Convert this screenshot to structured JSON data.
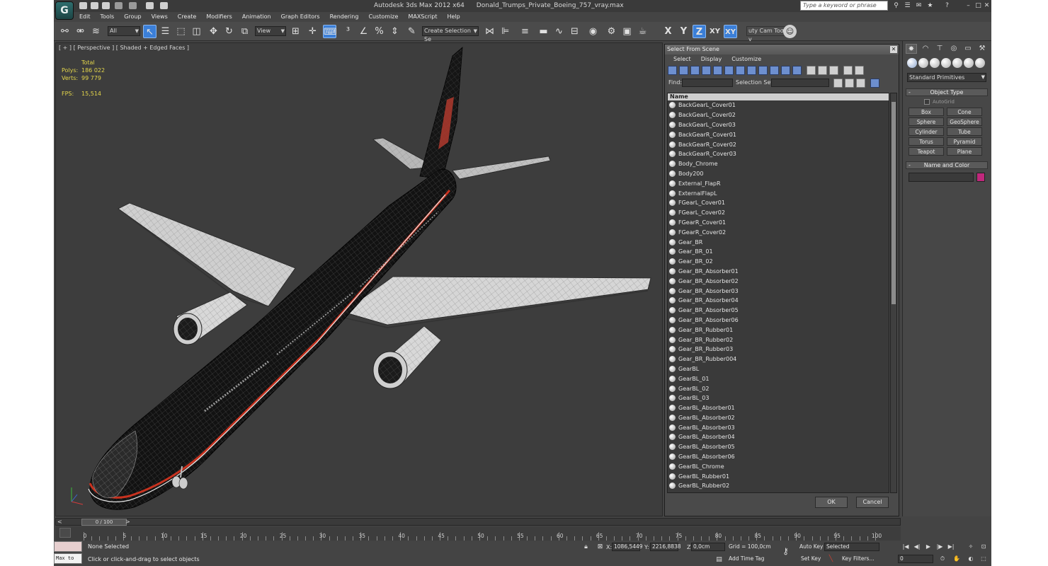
{
  "app": {
    "title_parts": [
      "Autodesk 3ds Max  2012 x64",
      "Donald_Trumps_Private_Boeing_757_vray.max"
    ],
    "logo_glyph": "G",
    "search_placeholder": "Type a keyword or phrase"
  },
  "menu": [
    "Edit",
    "Tools",
    "Group",
    "Views",
    "Create",
    "Modifiers",
    "Animation",
    "Graph Editors",
    "Rendering",
    "Customize",
    "MAXScript",
    "Help"
  ],
  "toolbar": {
    "filter_value": "All",
    "view_value": "View",
    "selection_set_placeholder": "Create Selection Se",
    "axis_x": "X",
    "axis_y": "Y",
    "axis_z": "Z",
    "axis_xy": "XY",
    "axis_xy2": "XY",
    "script_label": "uty Cam Tool v"
  },
  "viewport": {
    "label": "[ + ] [ Perspective ] [ Shaded + Edged Faces ]",
    "stats_total": "Total",
    "stats_polys_label": "Polys:",
    "stats_polys": "186 022",
    "stats_verts_label": "Verts:",
    "stats_verts": "99 779",
    "stats_fps_label": "FPS:",
    "stats_fps": "15,514"
  },
  "dialog": {
    "title": "Select From Scene",
    "menu": [
      "Select",
      "Display",
      "Customize"
    ],
    "find_label": "Find:",
    "selection_set_label": "Selection Set:",
    "column_name": "Name",
    "items": [
      "BackGearL_Cover01",
      "BackGearL_Cover02",
      "BackGearL_Cover03",
      "BackGearR_Cover01",
      "BackGearR_Cover02",
      "BackGearR_Cover03",
      "Body_Chrome",
      "Body200",
      "External_FlapR",
      "ExternalFlapL",
      "FGearL_Cover01",
      "FGearL_Cover02",
      "FGearR_Cover01",
      "FGearR_Cover02",
      "Gear_BR",
      "Gear_BR_01",
      "Gear_BR_02",
      "Gear_BR_Absorber01",
      "Gear_BR_Absorber02",
      "Gear_BR_Absorber03",
      "Gear_BR_Absorber04",
      "Gear_BR_Absorber05",
      "Gear_BR_Absorber06",
      "Gear_BR_Rubber01",
      "Gear_BR_Rubber02",
      "Gear_BR_Rubber03",
      "Gear_BR_Rubber004",
      "GearBL",
      "GearBL_01",
      "GearBL_02",
      "GearBL_03",
      "GearBL_Absorber01",
      "GearBL_Absorber02",
      "GearBL_Absorber03",
      "GearBL_Absorber04",
      "GearBL_Absorber05",
      "GearBL_Absorber06",
      "GearBL_Chrome",
      "GearBL_Rubber01",
      "GearBL_Rubber02"
    ],
    "ok_label": "OK",
    "cancel_label": "Cancel"
  },
  "command_panel": {
    "dropdown_value": "Standard Primitives",
    "object_type_title": "Object Type",
    "autogrid_label": "AutoGrid",
    "primitives": [
      "Box",
      "Cone",
      "Sphere",
      "GeoSphere",
      "Cylinder",
      "Tube",
      "Torus",
      "Pyramid",
      "Teapot",
      "Plane"
    ],
    "name_color_title": "Name and Color",
    "color": "#c0287c"
  },
  "timeline": {
    "frame_label": "0 / 100",
    "ticks": [
      0,
      5,
      10,
      15,
      20,
      25,
      30,
      35,
      40,
      45,
      50,
      55,
      60,
      65,
      70,
      75,
      80,
      85,
      90,
      95,
      100
    ]
  },
  "status": {
    "maxscript_label": "Max to",
    "selection_text": "None Selected",
    "prompt_text": "Click or click-and-drag to select objects",
    "x_label": "X:",
    "x_value": "1086,5449",
    "y_label": "Y:",
    "y_value": "2216,8838",
    "z_label": "Z:",
    "z_value": "0,0cm",
    "grid_text": "Grid = 100,0cm",
    "add_time_tag": "Add Time Tag",
    "auto_key": "Auto Key",
    "set_key": "Set Key",
    "key_mode_value": "Selected",
    "key_filters": "Key Filters...",
    "current_frame": "0"
  }
}
